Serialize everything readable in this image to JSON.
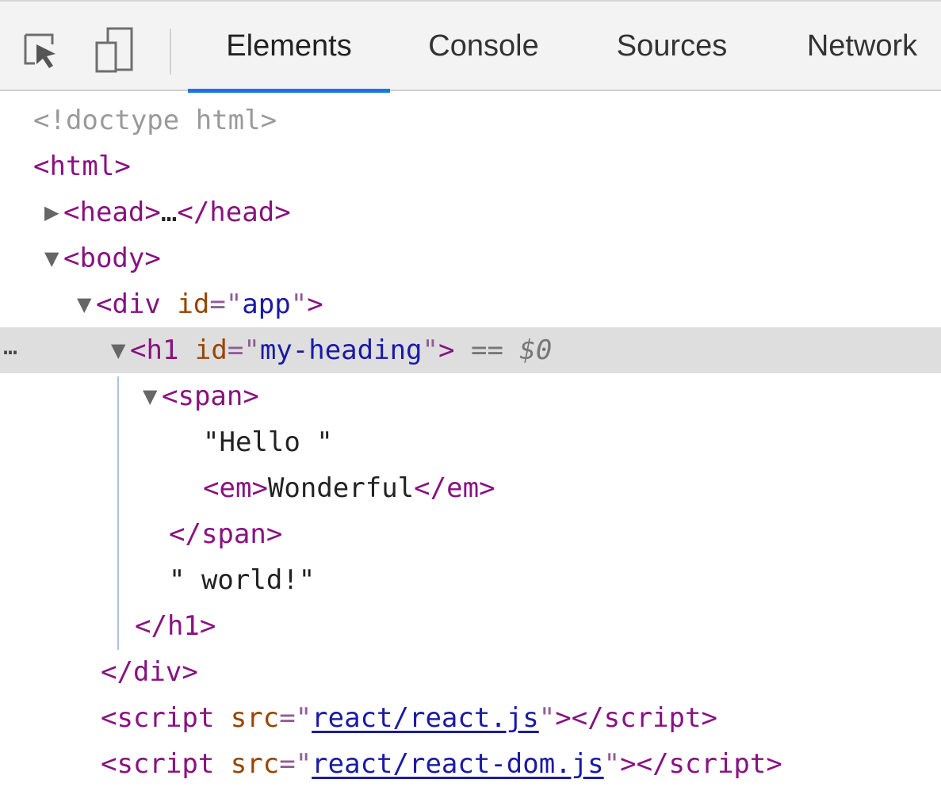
{
  "toolbar": {
    "tabs": [
      {
        "label": "Elements",
        "active": true
      },
      {
        "label": "Console",
        "active": false
      },
      {
        "label": "Sources",
        "active": false
      },
      {
        "label": "Network",
        "active": false
      }
    ],
    "icons": [
      "inspect-element-icon",
      "device-toolbar-icon"
    ]
  },
  "elements_tree": {
    "doctype": "<!doctype html>",
    "html_open": "html",
    "head_tag": "head",
    "head_ellipsis": "…",
    "body_tag": "body",
    "div_tag": "div",
    "div_attr_name": "id",
    "div_attr_value": "app",
    "selected_ellipsis": "…",
    "h1_tag": "h1",
    "h1_attr_name": "id",
    "h1_attr_value": "my-heading",
    "selected_marker_eq": "==",
    "selected_marker_var": "$0",
    "span_tag": "span",
    "text_hello": "\"Hello \"",
    "em_tag": "em",
    "em_text": "Wonderful",
    "text_world": "\" world!\"",
    "script_tag": "script",
    "script_attr_name": "src",
    "script_1_src": "react/react.js",
    "script_2_src": "react/react-dom.js"
  },
  "colors": {
    "tag": "#881280",
    "attribute_name": "#994500",
    "attribute_value": "#1a1aa6",
    "selection": "#dedede",
    "active_tab_underline": "#1a73e8"
  }
}
